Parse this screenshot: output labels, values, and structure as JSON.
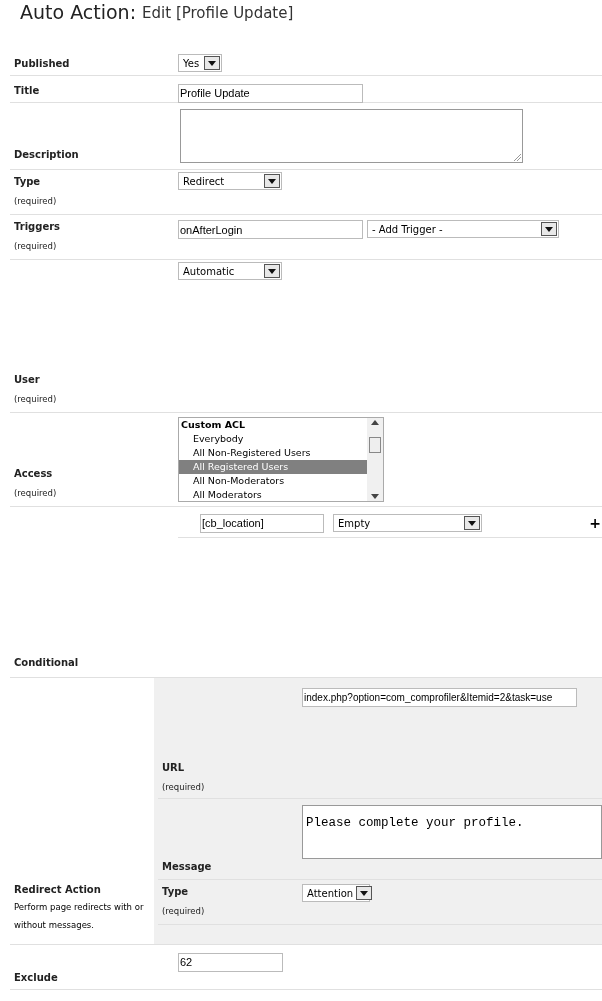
{
  "heading": {
    "prefix": "Auto Action:",
    "suffix": "Edit [Profile Update]"
  },
  "fields": [
    {
      "kind": "select",
      "label": "Published",
      "value": "Yes"
    },
    {
      "kind": "text",
      "label": "Title",
      "value": "Profile Update"
    },
    {
      "kind": "textarea",
      "label": "Description"
    },
    {
      "kind": "select",
      "label": "Type",
      "required": "(required)",
      "value": "Redirect"
    },
    {
      "kind": "triggers",
      "label": "Triggers",
      "required": "(required)",
      "value": "onAfterLogin",
      "add": "- Add Trigger -"
    },
    {
      "kind": "select",
      "label": "User",
      "required": "(required)",
      "value": "Automatic"
    },
    {
      "kind": "listbox",
      "label": "Access",
      "required": "(required)",
      "group": "Custom ACL",
      "options": [
        {
          "label": "Everybody",
          "selected": false
        },
        {
          "label": "All Non-Registered Users",
          "selected": false
        },
        {
          "label": "All Registered Users",
          "selected": true
        },
        {
          "label": "All Non-Moderators",
          "selected": false
        },
        {
          "label": "All Moderators",
          "selected": false
        }
      ]
    },
    {
      "kind": "condition",
      "label": "Conditional",
      "field": "[cb_location]",
      "operator": "Empty",
      "add": "+"
    },
    {
      "kind": "subform",
      "label": "Redirect Action",
      "description": "Perform page redirects with or without messages.",
      "fields": [
        {
          "kind": "text",
          "label": "URL",
          "required": "(required)",
          "value": "index.php?option=com_comprofiler&Itemid=2&task=use"
        },
        {
          "kind": "textarea",
          "label": "Message",
          "value": "Please complete your profile."
        },
        {
          "kind": "select",
          "label": "Type",
          "required": "(required)",
          "value": "Attention"
        }
      ]
    },
    {
      "kind": "text",
      "label": "Exclude",
      "value": "62"
    }
  ]
}
